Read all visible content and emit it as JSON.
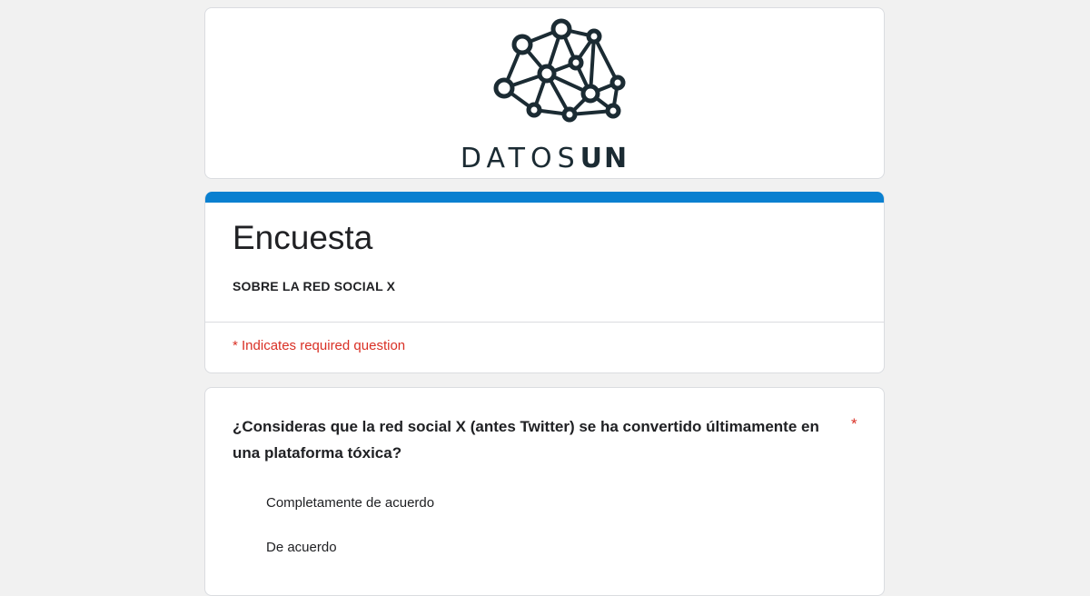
{
  "header": {
    "logo_text_light": "DATOS",
    "logo_text_bold": "UN",
    "logo_color": "#1b2b33"
  },
  "form": {
    "title": "Encuesta",
    "description": "SOBRE LA RED SOCIAL X",
    "required_note": "* Indicates required question",
    "accent_color": "#0a80d0"
  },
  "question": {
    "text": "¿Consideras que la red social X (antes Twitter) se ha convertido últimamente en una plataforma tóxica?",
    "required_mark": "*",
    "options": [
      {
        "label": "Completamente de acuerdo"
      },
      {
        "label": "De acuerdo"
      }
    ]
  }
}
